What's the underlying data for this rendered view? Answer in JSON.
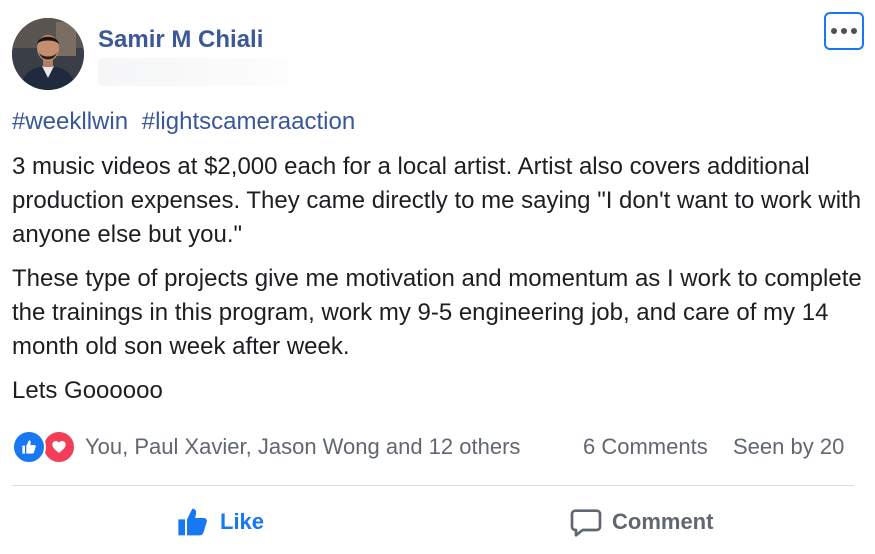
{
  "post": {
    "author_name": "Samir M Chiali",
    "more_icon": "more-horizontal-icon",
    "hashtags": [
      "#weekllwin",
      "#lightscameraaction"
    ],
    "paragraphs": [
      "3 music videos at $2,000 each for a local artist. Artist also covers additional production expenses. They came directly to me saying \"I don't want to work with anyone else but you.\"",
      "These type of projects give me motivation and momentum as I work to complete the trainings in this program, work my 9-5 engineering job, and care of my 14 month old son week after week.",
      "Lets Goooooo"
    ]
  },
  "reactions": {
    "icons": [
      "like-reaction-icon",
      "love-reaction-icon"
    ],
    "names": "You, Paul Xavier, Jason Wong and 12 others",
    "comments": "6 Comments",
    "seen_by": "Seen by 20"
  },
  "actions": {
    "like_label": "Like",
    "comment_label": "Comment"
  },
  "colors": {
    "link_blue": "#385898",
    "author_blue": "#3b5998",
    "like_blue": "#1877f2",
    "love_red": "#f33e58",
    "text": "#1c1e21",
    "muted": "#606770",
    "divider": "#dadde1"
  }
}
